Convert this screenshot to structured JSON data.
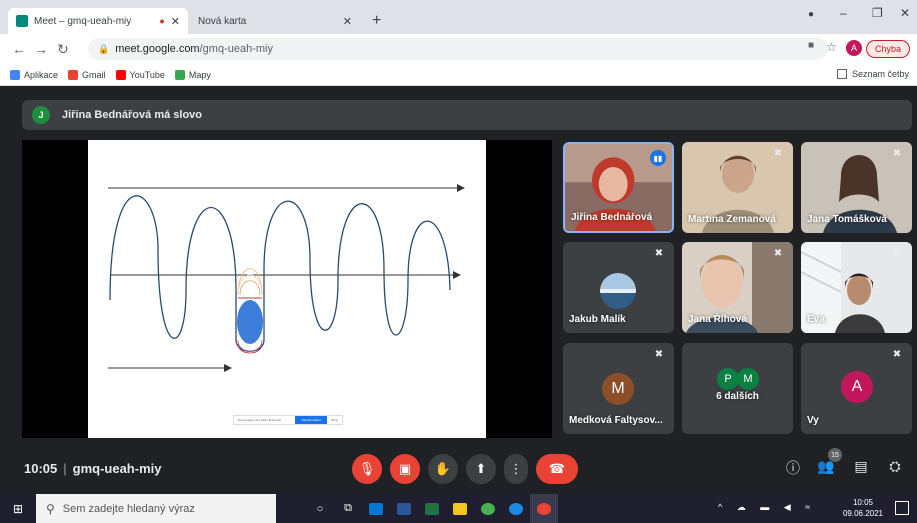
{
  "browser": {
    "tabs": [
      {
        "title": "Meet – gmq-ueah-miy",
        "favicon_color": "#00897b"
      },
      {
        "title": "Nová karta"
      }
    ],
    "new_tab_label": "+",
    "address": {
      "host": "meet.google.com",
      "path": "/gmq-ueah-miy"
    },
    "profile_initial": "A",
    "error_button": "Chyba",
    "bookmarks": [
      {
        "label": "Aplikace",
        "icon": "apps-grid-icon",
        "color": "#4285f4"
      },
      {
        "label": "Gmail",
        "icon": "gmail-icon",
        "color": "#ea4335"
      },
      {
        "label": "YouTube",
        "icon": "youtube-icon",
        "color": "#ff0000"
      },
      {
        "label": "Mapy",
        "icon": "maps-icon",
        "color": "#34a853"
      }
    ],
    "reading_list": "Seznam četby"
  },
  "meet": {
    "speaker_banner": {
      "initial": "J",
      "text": "Jiřina Bednářová má slovo"
    },
    "participants": [
      {
        "name": "Jiřina Bednářová",
        "speaking": true
      },
      {
        "name": "Martina Zemanová",
        "muted": true
      },
      {
        "name": "Jana Tomášková",
        "muted": true
      },
      {
        "name": "Jakub Malík",
        "muted": true
      },
      {
        "name": "Jana Říhová",
        "muted": true
      },
      {
        "name": "Eva",
        "muted": true
      },
      {
        "name": "Medková Faltysov...",
        "initial": "M",
        "muted": true,
        "color": "#8d4e2a"
      },
      {
        "name": "6 dalších",
        "initials": [
          "P",
          "M"
        ],
        "color": "#0b8043"
      },
      {
        "name": "Vy",
        "initial": "A",
        "muted": true,
        "color": "#c2185b"
      }
    ],
    "slide_bar": {
      "text": "meet.google.com sdílí obrazovku.",
      "stop": "Ukončit sdílení",
      "hide": "Skrýt"
    },
    "time": "10:05",
    "separator": "|",
    "meeting_code": "gmq-ueah-miy",
    "participant_count": "15"
  },
  "taskbar": {
    "search_placeholder": "Sem zadejte hledaný výraz",
    "clock_time": "10:05",
    "clock_date": "09.06.2021"
  }
}
